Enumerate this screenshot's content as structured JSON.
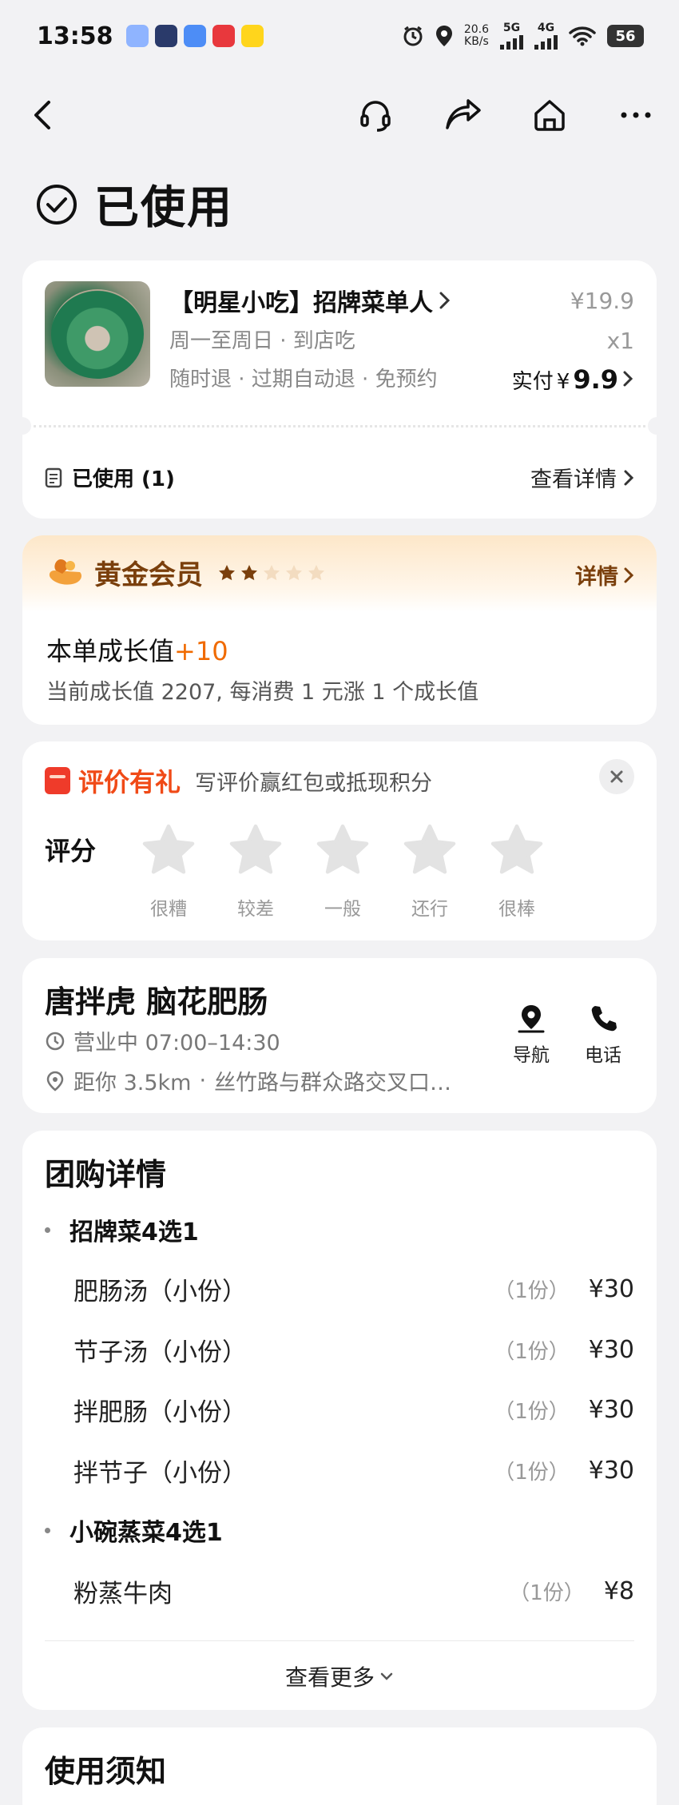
{
  "status_bar": {
    "time": "13:58",
    "speed_value": "20.6",
    "speed_unit": "KB/s",
    "net1": "5G",
    "net2": "4G",
    "battery": "56"
  },
  "nav": {
    "back_icon": "chevron-left-icon",
    "service_icon": "headset-icon",
    "share_icon": "share-arrow-icon",
    "home_icon": "home-icon",
    "more_icon": "more-dots-icon"
  },
  "page": {
    "status_title": "已使用"
  },
  "order": {
    "deal_name": "【明星小吃】招牌菜单人",
    "schedule": "周一至周日 · 到店吃",
    "policy": "随时退 · 过期自动退 · 免预约",
    "original_price": "¥19.9",
    "quantity": "x1",
    "paid_label": "实付",
    "paid_currency": "¥",
    "paid_amount": "9.9",
    "used_label": "已使用 (1)",
    "view_details": "查看详情"
  },
  "member": {
    "level": "黄金会员",
    "stars_filled": 2,
    "stars_total": 5,
    "detail_link": "详情",
    "growth_label": "本单成长值",
    "growth_value": "+10",
    "growth_desc": "当前成长值 2207, 每消费 1 元涨 1 个成长值"
  },
  "review": {
    "title": "评价有礼",
    "subtitle": "写评价赢红包或抵现积分",
    "score_label": "评分",
    "star_labels": [
      "很糟",
      "较差",
      "一般",
      "还行",
      "很棒"
    ]
  },
  "store": {
    "name": "唐拌虎 脑花肥肠",
    "hours": "营业中 07:00–14:30",
    "distance": "距你 3.5km",
    "address": "丝竹路与群众路交叉口…",
    "nav_label": "导航",
    "phone_label": "电话"
  },
  "group": {
    "title": "团购详情",
    "sections": [
      {
        "name": "招牌菜4选1",
        "items": [
          {
            "name": "肥肠汤（小份）",
            "qty": "（1份）",
            "price": "¥30"
          },
          {
            "name": "节子汤（小份）",
            "qty": "（1份）",
            "price": "¥30"
          },
          {
            "name": "拌肥肠（小份）",
            "qty": "（1份）",
            "price": "¥30"
          },
          {
            "name": "拌节子（小份）",
            "qty": "（1份）",
            "price": "¥30"
          }
        ]
      },
      {
        "name": "小碗蒸菜4选1",
        "items": [
          {
            "name": "粉蒸牛肉",
            "qty": "（1份）",
            "price": "¥8"
          }
        ]
      }
    ],
    "see_more": "查看更多"
  },
  "notice": {
    "title": "使用须知"
  },
  "colors": {
    "background": "#f2f2f4",
    "accent_orange": "#f06a00",
    "gold_text": "#7a3f0c",
    "review_red": "#f04a17",
    "star_gray": "#e3e3e3"
  }
}
